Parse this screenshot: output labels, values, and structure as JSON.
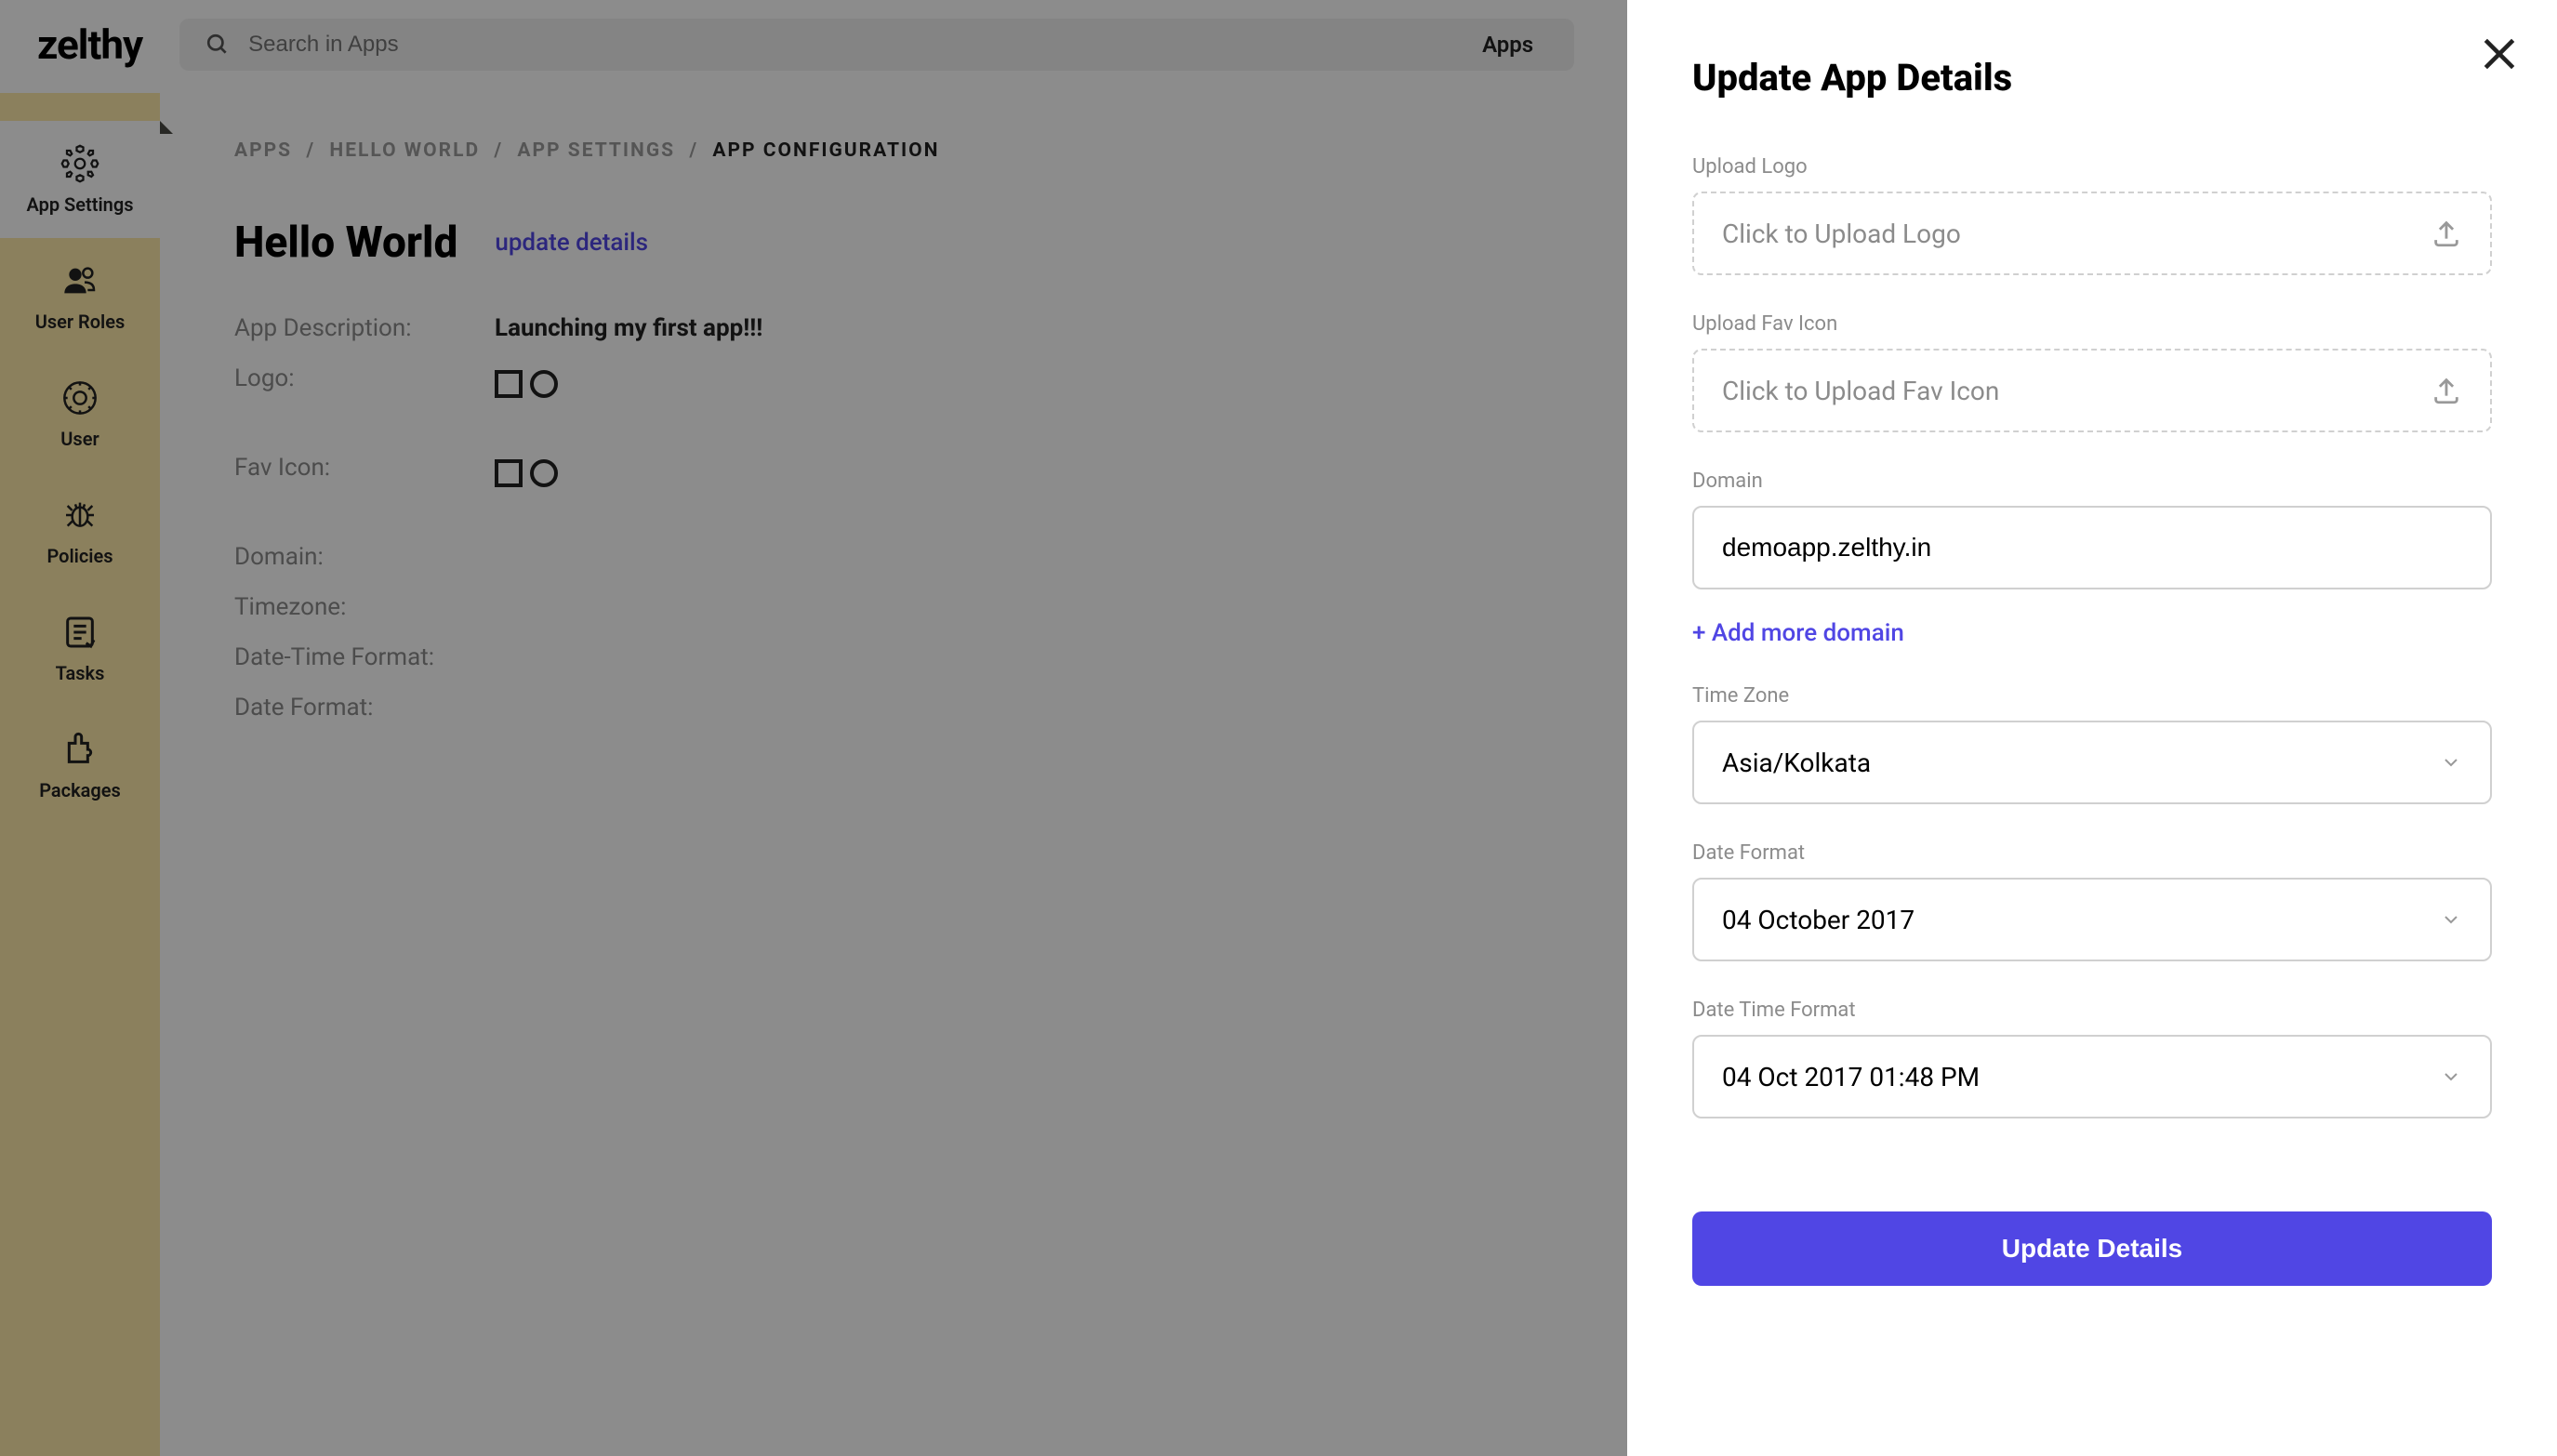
{
  "brand": "zelthy",
  "search": {
    "placeholder": "Search in Apps",
    "tag": "Apps"
  },
  "sidebar": {
    "items": [
      {
        "label": "App Settings",
        "active": true
      },
      {
        "label": "User Roles"
      },
      {
        "label": "User"
      },
      {
        "label": "Policies"
      },
      {
        "label": "Tasks"
      },
      {
        "label": "Packages"
      }
    ]
  },
  "breadcrumb": {
    "parts": [
      "APPS",
      "HELLO WORLD",
      "APP SETTINGS"
    ],
    "current": "APP CONFIGURATION"
  },
  "main": {
    "title": "Hello World",
    "update_link": "update details",
    "details": {
      "description_label": "App Description:",
      "description_value": "Launching my first app!!!",
      "logo_label": "Logo:",
      "favicon_label": "Fav Icon:",
      "domain_label": "Domain:",
      "timezone_label": "Timezone:",
      "datetime_format_label": "Date-Time Format:",
      "date_format_label": "Date Format:"
    }
  },
  "drawer": {
    "title": "Update App Details",
    "upload_logo_label": "Upload Logo",
    "upload_logo_placeholder": "Click to Upload Logo",
    "upload_favicon_label": "Upload Fav Icon",
    "upload_favicon_placeholder": "Click to Upload Fav Icon",
    "domain_label": "Domain",
    "domain_value": "demoapp.zelthy.in",
    "add_more_domain": "+ Add more domain",
    "timezone_label": "Time Zone",
    "timezone_value": "Asia/Kolkata",
    "date_format_label": "Date Format",
    "date_format_value": "04 October 2017",
    "datetime_format_label": "Date Time Format",
    "datetime_format_value": "04 Oct 2017 01:48 PM",
    "submit": "Update Details"
  }
}
